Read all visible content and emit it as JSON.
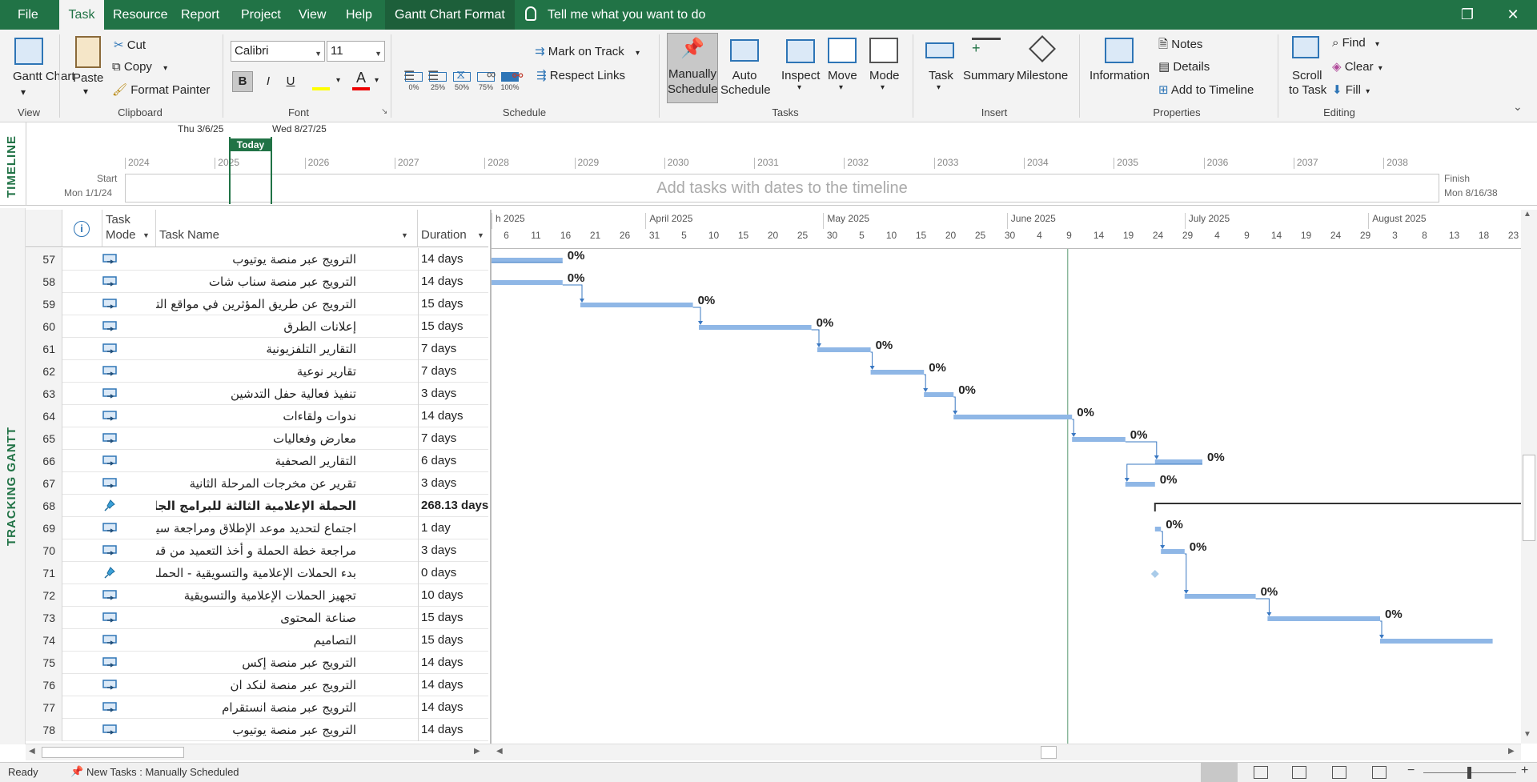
{
  "menubar": {
    "tabs": [
      "File",
      "Task",
      "Resource",
      "Report",
      "Project",
      "View",
      "Help",
      "Gantt Chart Format"
    ],
    "active_tab": "Task",
    "tell_me": "Tell me what you want to do"
  },
  "ribbon": {
    "view": {
      "gantt_chart": "Gantt Chart",
      "group": "View"
    },
    "clipboard": {
      "paste": "Paste",
      "cut": "Cut",
      "copy": "Copy",
      "format_painter": "Format Painter",
      "group": "Clipboard"
    },
    "font": {
      "family": "Calibri",
      "size": "11",
      "bold": "B",
      "italic": "I",
      "underline": "U",
      "group": "Font"
    },
    "schedule": {
      "percents": [
        "0%",
        "25%",
        "50%",
        "75%",
        "100%"
      ],
      "mark_on_track": "Mark on Track",
      "respect_links": "Respect Links",
      "group": "Schedule"
    },
    "tasks": {
      "manually": "Manually",
      "schedule1": "Schedule",
      "auto": "Auto",
      "schedule2": "Schedule",
      "inspect": "Inspect",
      "move": "Move",
      "mode": "Mode",
      "group": "Tasks"
    },
    "insert": {
      "task": "Task",
      "summary": "Summary",
      "milestone": "Milestone",
      "group": "Insert"
    },
    "properties": {
      "information": "Information",
      "notes": "Notes",
      "details": "Details",
      "add_to_timeline": "Add to Timeline",
      "group": "Properties"
    },
    "editing": {
      "scroll": "Scroll",
      "to_task": "to Task",
      "find": "Find",
      "clear": "Clear",
      "fill": "Fill",
      "group": "Editing"
    }
  },
  "timeline": {
    "side_label": "TIMELINE",
    "years": [
      "2024",
      "2025",
      "2026",
      "2027",
      "2028",
      "2029",
      "2030",
      "2031",
      "2032",
      "2033",
      "2034",
      "2035",
      "2036",
      "2037",
      "2038"
    ],
    "hint": "Add tasks with dates to the timeline",
    "start_label": "Start",
    "start_date": "Mon 1/1/24",
    "finish_label": "Finish",
    "finish_date": "Mon 8/16/38",
    "range_start": "Thu 3/6/25",
    "range_end": "Wed 8/27/25",
    "today": "Today"
  },
  "gantt_side_label": "TRACKING GANTT",
  "grid": {
    "col_task_mode": [
      "Task",
      "Mode"
    ],
    "col_task_name": "Task Name",
    "col_duration": "Duration",
    "rows": [
      {
        "id": "57",
        "name": "الترويج عبر منصة يوتيوب",
        "duration": "14 days",
        "type": "auto",
        "start": -2,
        "len": 14,
        "label": "0%"
      },
      {
        "id": "58",
        "name": "الترويج عبر منصة سناب شات",
        "duration": "14 days",
        "type": "auto",
        "start": -2,
        "len": 14,
        "label": "0%"
      },
      {
        "id": "59",
        "name": "الترويج عن طريق المؤثرين في مواقع التواصل الاجتماعي",
        "duration": "15 days",
        "type": "auto",
        "start": 15,
        "len": 19,
        "label": "0%"
      },
      {
        "id": "60",
        "name": "إعلانات الطرق",
        "duration": "15 days",
        "type": "auto",
        "start": 35,
        "len": 19,
        "label": "0%"
      },
      {
        "id": "61",
        "name": "التقارير التلفزيونية",
        "duration": "7 days",
        "type": "auto",
        "start": 55,
        "len": 9,
        "label": "0%"
      },
      {
        "id": "62",
        "name": "تقارير نوعية",
        "duration": "7 days",
        "type": "auto",
        "start": 64,
        "len": 9,
        "label": "0%"
      },
      {
        "id": "63",
        "name": "تنفيذ فعالية حفل التدشين",
        "duration": "3 days",
        "type": "auto",
        "start": 73,
        "len": 5,
        "label": "0%"
      },
      {
        "id": "64",
        "name": "ندوات ولقاءات",
        "duration": "14 days",
        "type": "auto",
        "start": 78,
        "len": 20,
        "label": "0%"
      },
      {
        "id": "65",
        "name": "معارض وفعاليات",
        "duration": "7 days",
        "type": "auto",
        "start": 98,
        "len": 9,
        "label": "0%"
      },
      {
        "id": "66",
        "name": "التقارير الصحفية",
        "duration": "6 days",
        "type": "auto",
        "start": 112,
        "len": 8,
        "label": "0%"
      },
      {
        "id": "67",
        "name": "تقرير عن مخرجات المرحلة الثانية",
        "duration": "3 days",
        "type": "auto",
        "start": 107,
        "len": 5,
        "label": "0%"
      },
      {
        "id": "68",
        "name": "الحملة الإعلامية الثالثة للبرامج الجامعية القصيرة",
        "duration": "268.13 days",
        "type": "summary",
        "start": 112,
        "len": 80,
        "label": ""
      },
      {
        "id": "69",
        "name": "اجتماع لتحديد موعد الإطلاق ومراجعة سير العمل",
        "duration": "1 day",
        "type": "auto",
        "start": 112,
        "len": 1,
        "label": "0%"
      },
      {
        "id": "70",
        "name": "مراجعة خطة الحملة و أخذ التعميد من قسم الإتصال المؤسسي",
        "duration": "3 days",
        "type": "auto",
        "start": 113,
        "len": 4,
        "label": "0%"
      },
      {
        "id": "71",
        "name": "بدء الحملات الإعلامية والتسويقية - الحملة الثالثة",
        "duration": "0 days",
        "type": "milestone",
        "start": 112,
        "len": 0,
        "label": ""
      },
      {
        "id": "72",
        "name": "تجهيز الحملات الإعلامية والتسويقية",
        "duration": "10 days",
        "type": "auto",
        "start": 117,
        "len": 12,
        "label": "0%"
      },
      {
        "id": "73",
        "name": "صناعة المحتوى",
        "duration": "15 days",
        "type": "auto",
        "start": 131,
        "len": 19,
        "label": "0%"
      },
      {
        "id": "74",
        "name": "التصاميم",
        "duration": "15 days",
        "type": "auto",
        "start": 150,
        "len": 19,
        "label": ""
      },
      {
        "id": "75",
        "name": "الترويج عبر منصة إكس",
        "duration": "14 days",
        "type": "auto",
        "start": 0,
        "len": 0,
        "label": ""
      },
      {
        "id": "76",
        "name": "الترويج عبر منصة لنكد ان",
        "duration": "14 days",
        "type": "auto",
        "start": 0,
        "len": 0,
        "label": ""
      },
      {
        "id": "77",
        "name": "الترويج عبر منصة انستقرام",
        "duration": "14 days",
        "type": "auto",
        "start": 0,
        "len": 0,
        "label": ""
      },
      {
        "id": "78",
        "name": "الترويج عبر منصة يوتيوب",
        "duration": "14 days",
        "type": "auto",
        "start": 0,
        "len": 0,
        "label": ""
      }
    ]
  },
  "gantt": {
    "months": [
      {
        "label": "h 2025",
        "at": 0
      },
      {
        "label": "April 2025",
        "at": 26
      },
      {
        "label": "May 2025",
        "at": 56
      },
      {
        "label": "June 2025",
        "at": 87
      },
      {
        "label": "July 2025",
        "at": 117
      },
      {
        "label": "August 2025",
        "at": 148
      }
    ],
    "day_ticks": [
      "6",
      "11",
      "16",
      "21",
      "26",
      "31",
      "5",
      "10",
      "15",
      "20",
      "25",
      "30",
      "5",
      "10",
      "15",
      "20",
      "25",
      "30",
      "4",
      "9",
      "14",
      "19",
      "24",
      "29",
      "4",
      "9",
      "14",
      "19",
      "24",
      "29",
      "3",
      "8",
      "13",
      "18",
      "23"
    ],
    "today_day": 97,
    "bar_color": "#8fb7e6",
    "link_color": "#3a78c2"
  },
  "status": {
    "ready": "Ready",
    "new_tasks": "New Tasks : Manually Scheduled"
  },
  "colors": {
    "accent": "#217346"
  }
}
